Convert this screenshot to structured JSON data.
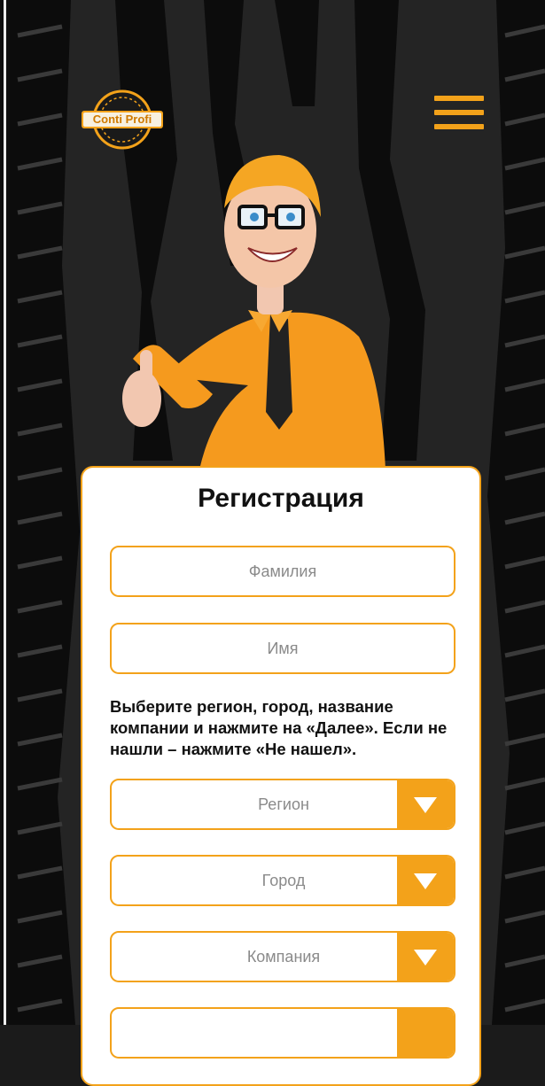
{
  "header": {
    "logo_text": "Conti Profi",
    "menu_icon": "hamburger-menu-icon"
  },
  "form": {
    "title": "Регистрация",
    "surname_placeholder": "Фамилия",
    "name_placeholder": "Имя",
    "help_text": "Выберите регион, город, название компании и нажмите на «Далее». Если не нашли – нажмите «Не нашел».",
    "region_label": "Регион",
    "city_label": "Город",
    "company_label": "Компания",
    "dropdown_icon": "triangle-down-icon"
  },
  "colors": {
    "accent": "#f3a21a",
    "background": "#1b1b1b",
    "card": "#ffffff"
  }
}
